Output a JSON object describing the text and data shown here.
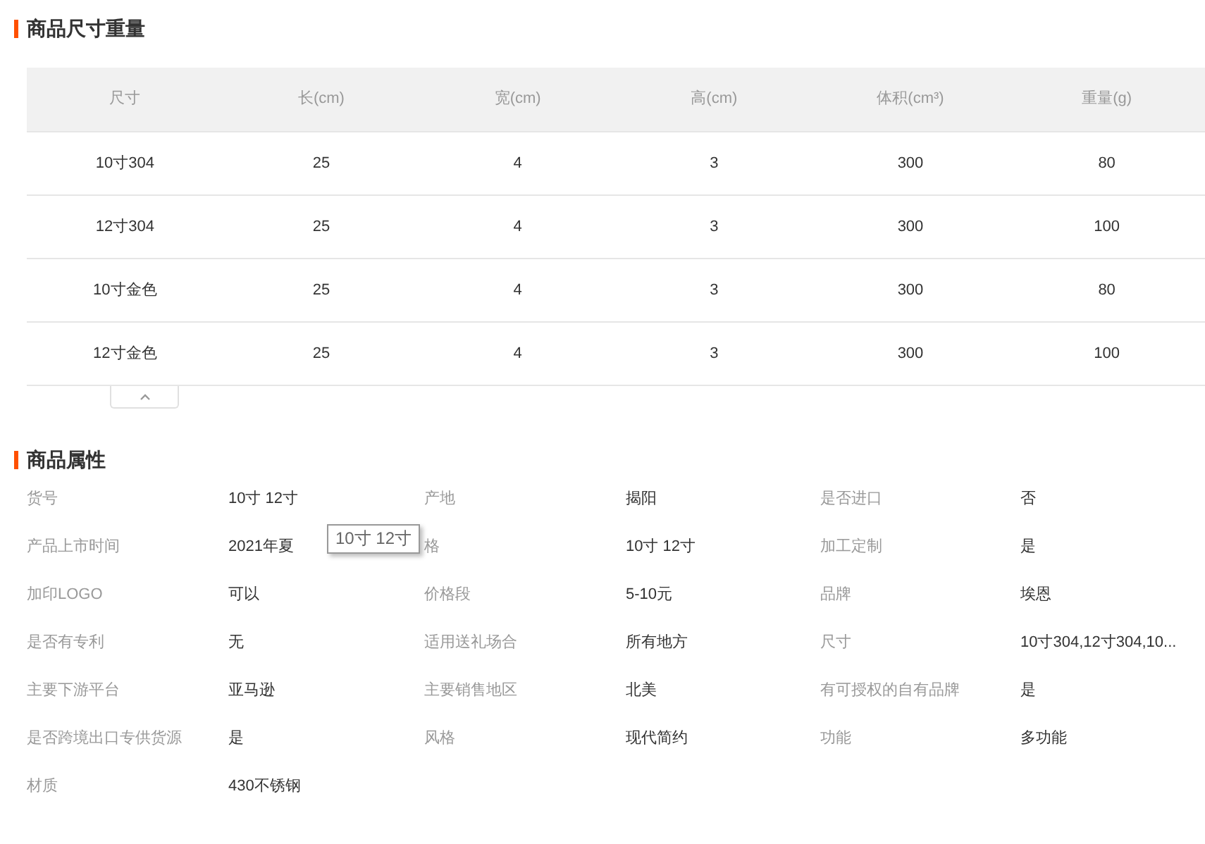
{
  "size_section": {
    "title": "商品尺寸重量",
    "columns": [
      "尺寸",
      "长(cm)",
      "宽(cm)",
      "高(cm)",
      "体积(cm³)",
      "重量(g)"
    ],
    "rows": [
      [
        "10寸304",
        "25",
        "4",
        "3",
        "300",
        "80"
      ],
      [
        "12寸304",
        "25",
        "4",
        "3",
        "300",
        "100"
      ],
      [
        "10寸金色",
        "25",
        "4",
        "3",
        "300",
        "80"
      ],
      [
        "12寸金色",
        "25",
        "4",
        "3",
        "300",
        "100"
      ]
    ]
  },
  "attributes_section": {
    "title": "商品属性",
    "attributes": [
      {
        "label": "货号",
        "value": "10寸 12寸"
      },
      {
        "label": "产地",
        "value": "揭阳"
      },
      {
        "label": "是否进口",
        "value": "否"
      },
      {
        "label": "产品上市时间",
        "value": "2021年夏"
      },
      {
        "label": "格",
        "value": "10寸 12寸"
      },
      {
        "label": "加工定制",
        "value": "是"
      },
      {
        "label": "加印LOGO",
        "value": "可以"
      },
      {
        "label": "价格段",
        "value": "5-10元"
      },
      {
        "label": "品牌",
        "value": "埃恩"
      },
      {
        "label": "是否有专利",
        "value": "无"
      },
      {
        "label": "适用送礼场合",
        "value": "所有地方"
      },
      {
        "label": "尺寸",
        "value": "10寸304,12寸304,10..."
      },
      {
        "label": "主要下游平台",
        "value": "亚马逊"
      },
      {
        "label": "主要销售地区",
        "value": "北美"
      },
      {
        "label": "有可授权的自有品牌",
        "value": "是"
      },
      {
        "label": "是否跨境出口专供货源",
        "value": "是"
      },
      {
        "label": "风格",
        "value": "现代简约"
      },
      {
        "label": "功能",
        "value": "多功能"
      },
      {
        "label": "材质",
        "value": "430不锈钢"
      }
    ]
  },
  "tooltip": {
    "text": "10寸 12寸"
  }
}
